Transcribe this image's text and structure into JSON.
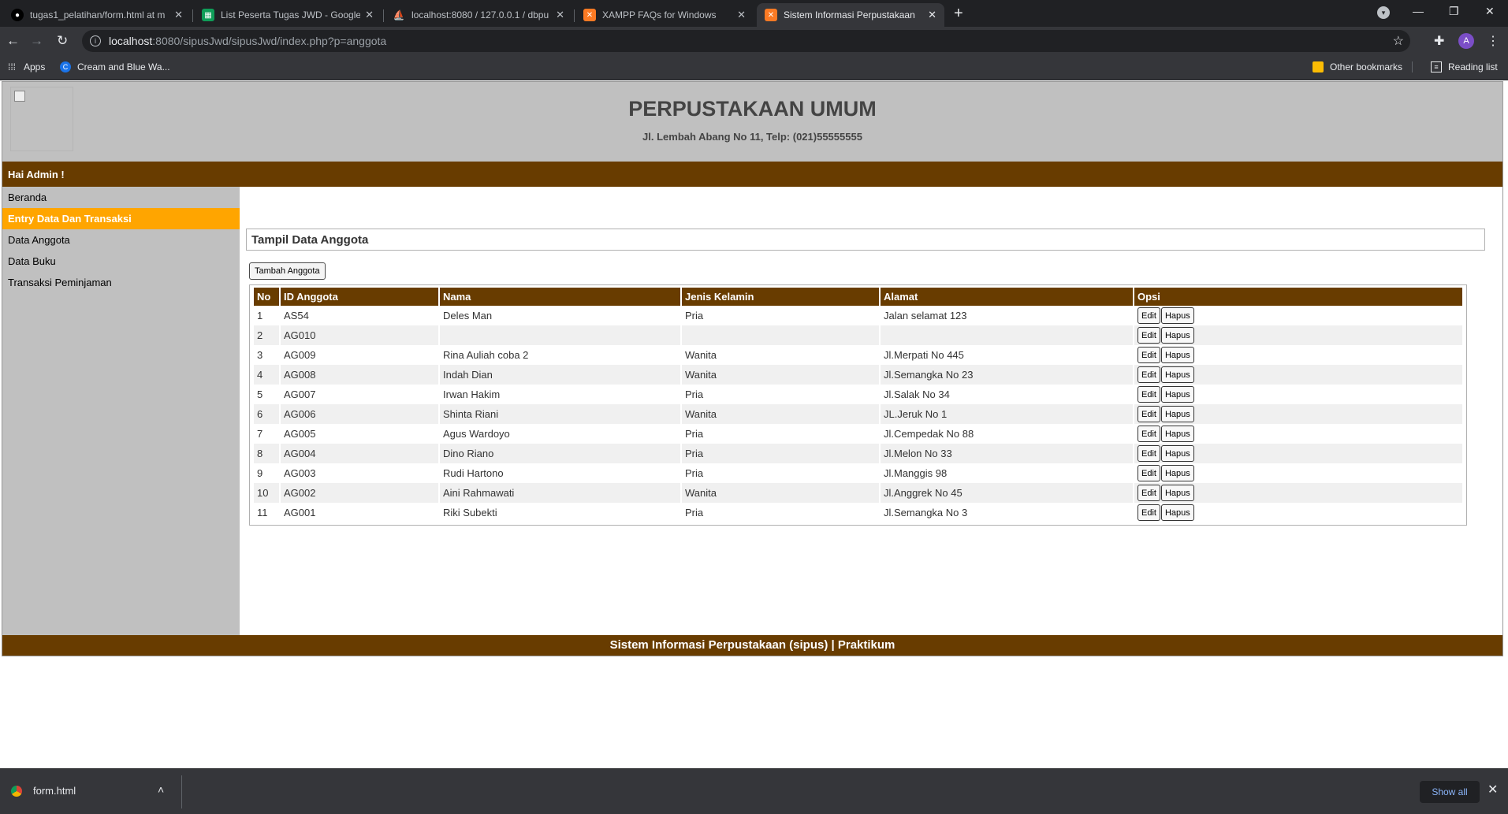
{
  "browser": {
    "tabs": [
      {
        "title": "tugas1_pelatihan/form.html at m",
        "icon": "github-icon"
      },
      {
        "title": "List Peserta Tugas JWD - Google",
        "icon": "sheets-icon"
      },
      {
        "title": "localhost:8080 / 127.0.0.1 / dbpu",
        "icon": "phpmyadmin-icon"
      },
      {
        "title": "XAMPP FAQs for Windows",
        "icon": "xampp-icon"
      },
      {
        "title": "Sistem Informasi Perpustakaan",
        "icon": "xampp-icon"
      }
    ],
    "url_host": "localhost",
    "url_rest": ":8080/sipusJwd/sipusJwd/index.php?p=anggota",
    "avatar_letter": "A",
    "bookmarks": {
      "apps": "Apps",
      "item1": "Cream and Blue Wa...",
      "other": "Other bookmarks",
      "reading": "Reading list"
    }
  },
  "header": {
    "title": "PERPUSTAKAAN UMUM",
    "subtitle": "Jl. Lembah Abang No 11, Telp: (021)55555555"
  },
  "greeting": "Hai Admin !",
  "sidebar": {
    "items": [
      {
        "label": "Beranda"
      },
      {
        "label": "Entry Data Dan Transaksi"
      },
      {
        "label": "Data Anggota"
      },
      {
        "label": "Data Buku"
      },
      {
        "label": "Transaksi Peminjaman"
      }
    ]
  },
  "main": {
    "panel_title": "Tampil Data Anggota",
    "add_button": "Tambah Anggota",
    "columns": [
      "No",
      "ID Anggota",
      "Nama",
      "Jenis Kelamin",
      "Alamat",
      "Opsi"
    ],
    "edit_label": "Edit",
    "delete_label": "Hapus",
    "rows": [
      {
        "no": "1",
        "id": "AS54",
        "nama": "Deles Man",
        "jk": "Pria",
        "alamat": "Jalan selamat 123"
      },
      {
        "no": "2",
        "id": "AG010",
        "nama": "",
        "jk": "",
        "alamat": ""
      },
      {
        "no": "3",
        "id": "AG009",
        "nama": "Rina Auliah coba 2",
        "jk": "Wanita",
        "alamat": "Jl.Merpati No 445"
      },
      {
        "no": "4",
        "id": "AG008",
        "nama": "Indah Dian",
        "jk": "Wanita",
        "alamat": "Jl.Semangka No 23"
      },
      {
        "no": "5",
        "id": "AG007",
        "nama": "Irwan Hakim",
        "jk": "Pria",
        "alamat": "Jl.Salak No 34"
      },
      {
        "no": "6",
        "id": "AG006",
        "nama": "Shinta Riani",
        "jk": "Wanita",
        "alamat": "JL.Jeruk No 1"
      },
      {
        "no": "7",
        "id": "AG005",
        "nama": "Agus Wardoyo",
        "jk": "Pria",
        "alamat": "Jl.Cempedak No 88"
      },
      {
        "no": "8",
        "id": "AG004",
        "nama": "Dino Riano",
        "jk": "Pria",
        "alamat": "Jl.Melon No 33"
      },
      {
        "no": "9",
        "id": "AG003",
        "nama": "Rudi Hartono",
        "jk": "Pria",
        "alamat": "Jl.Manggis 98"
      },
      {
        "no": "10",
        "id": "AG002",
        "nama": "Aini Rahmawati",
        "jk": "Wanita",
        "alamat": "Jl.Anggrek No 45"
      },
      {
        "no": "11",
        "id": "AG001",
        "nama": "Riki Subekti",
        "jk": "Pria",
        "alamat": "Jl.Semangka No 3"
      }
    ]
  },
  "footer": "Sistem Informasi Perpustakaan (sipus) | Praktikum",
  "download_bar": {
    "file": "form.html",
    "show_all": "Show all"
  },
  "colors": {
    "brown": "#683c00",
    "orange": "#ffa500",
    "gray": "#c0c0c0"
  }
}
